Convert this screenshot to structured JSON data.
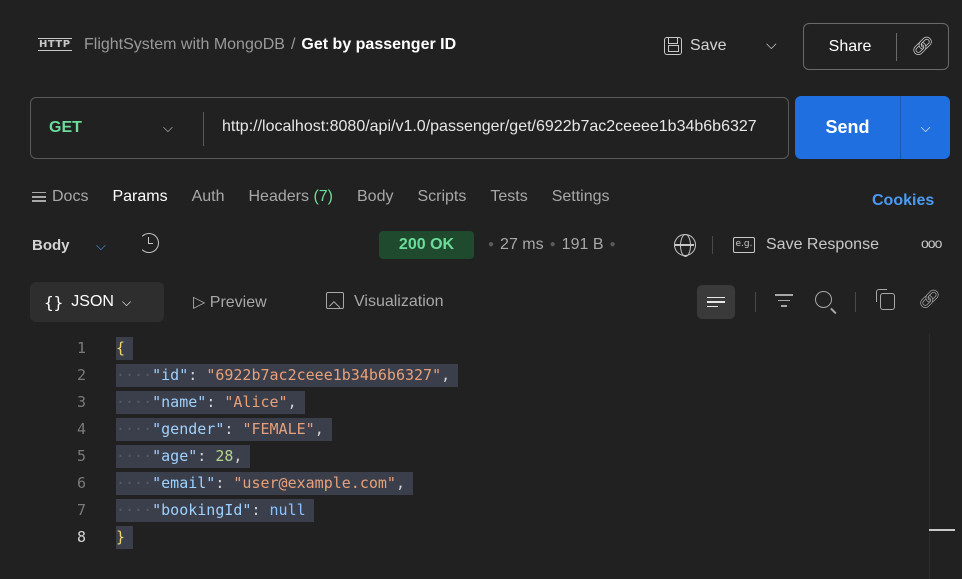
{
  "header": {
    "http_icon": "HTTP",
    "collection": "FlightSystem with MongoDB",
    "separator": "/",
    "request_name": "Get by passenger ID",
    "save_label": "Save",
    "share_label": "Share"
  },
  "request": {
    "method": "GET",
    "url": "http://localhost:8080/api/v1.0/passenger/get/6922b7ac2ceeee1b34b6b6327",
    "send_label": "Send"
  },
  "tabs": {
    "docs": "Docs",
    "params": "Params",
    "auth": "Auth",
    "headers": "Headers",
    "headers_count": "(7)",
    "body": "Body",
    "scripts": "Scripts",
    "tests": "Tests",
    "settings": "Settings",
    "cookies": "Cookies"
  },
  "response": {
    "body_label": "Body",
    "status": "200 OK",
    "time": "27 ms",
    "size": "191 B",
    "eg_icon": "e.g.",
    "save_response": "Save Response",
    "format": "JSON",
    "preview": "Preview",
    "visualization": "Visualization"
  },
  "code": {
    "line_numbers": [
      "1",
      "2",
      "3",
      "4",
      "5",
      "6",
      "7",
      "8"
    ],
    "open_brace": "{",
    "close_brace": "}",
    "fields": [
      {
        "key": "\"id\"",
        "value": "\"6922b7ac2ceee1b34b6b6327\"",
        "comma": ","
      },
      {
        "key": "\"name\"",
        "value": "\"Alice\"",
        "comma": ","
      },
      {
        "key": "\"gender\"",
        "value": "\"FEMALE\"",
        "comma": ","
      },
      {
        "key": "\"age\"",
        "value": "28",
        "comma": ","
      },
      {
        "key": "\"email\"",
        "value": "\"user@example.com\"",
        "comma": ","
      },
      {
        "key": "\"bookingId\"",
        "value": "null",
        "comma": ""
      }
    ]
  },
  "colors": {
    "background": "#212121",
    "accent_blue": "#1f6fe0",
    "method_green": "#6bdd9a",
    "status_bg": "#1f4a2e",
    "link_blue": "#4b9bf5"
  }
}
